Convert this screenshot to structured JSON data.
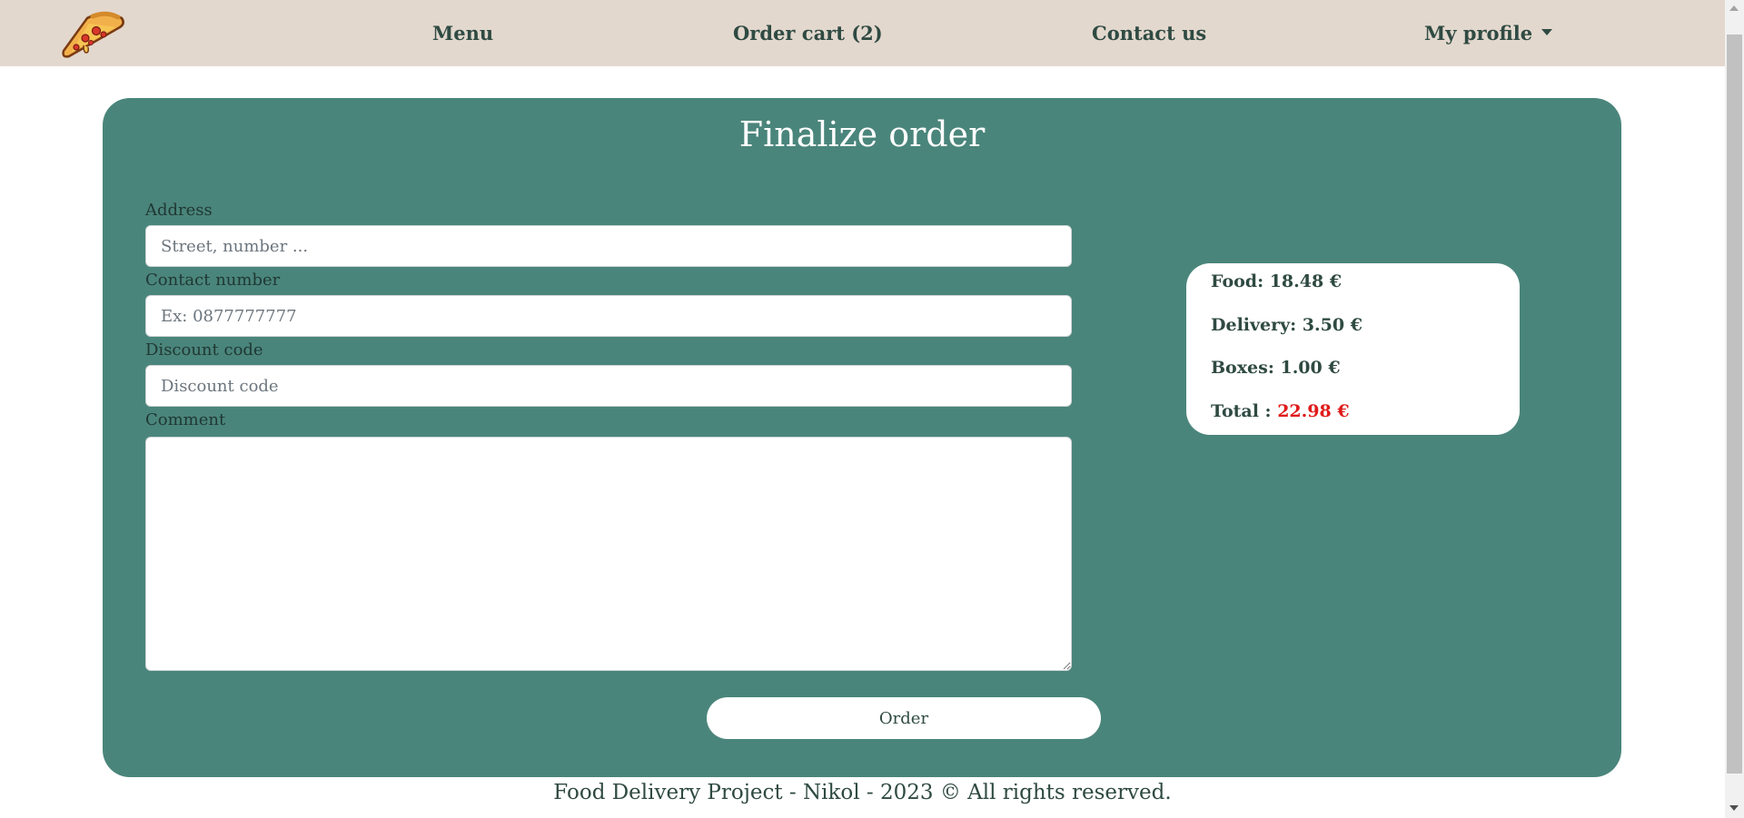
{
  "navbar": {
    "logo_name": "pizza-slice-logo",
    "menu_label": "Menu",
    "cart_label": "Order cart (2)",
    "contact_label": "Contact us",
    "profile_label": "My profile"
  },
  "form": {
    "title": "Finalize order",
    "address_label": "Address",
    "address_placeholder": "Street, number ...",
    "address_value": "",
    "contact_label": "Contact number",
    "contact_placeholder": "Ex: 0877777777",
    "contact_value": "",
    "discount_label": "Discount code",
    "discount_placeholder": "Discount code",
    "discount_value": "",
    "comment_label": "Comment",
    "comment_value": "",
    "submit_label": "Order"
  },
  "summary": {
    "food": "Food: 18.48 €",
    "delivery": "Delivery: 3.50 €",
    "boxes": "Boxes: 1.00 €",
    "total_label": "Total :",
    "total_value": "22.98 €"
  },
  "footer": {
    "text": "Food Delivery Project - Nikol - 2023 © All rights reserved."
  },
  "colors": {
    "navbar_bg": "#e3d8ce",
    "card_bg": "#4a857b",
    "text": "#2f4a42",
    "total_accent": "#e01b1b"
  }
}
